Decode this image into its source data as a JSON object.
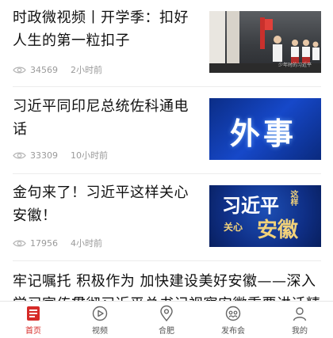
{
  "articles": [
    {
      "title": "时政微视频丨开学季：扣好人生的第一粒扣子",
      "views": "34569",
      "time": "2小时前",
      "thumb_caption": "少年时的习近平",
      "thumb_icon": "classroom-photo"
    },
    {
      "title": "习近平同印尼总统佐科通电话",
      "views": "33309",
      "time": "10小时前",
      "thumb_text": "外事",
      "thumb_icon": "waishi-banner"
    },
    {
      "title": "金句来了！习近平这样关心安徽！",
      "views": "17956",
      "time": "4小时前",
      "thumb_texts": [
        "习近平",
        "这样",
        "关心",
        "安徽"
      ],
      "thumb_icon": "anhui-banner"
    }
  ],
  "long_article": {
    "title": "牢记嘱托 积极作为 加快建设美好安徽——深入学习宣传贯彻习近平总书记视察安徽重要讲话精神"
  },
  "tabbar": {
    "items": [
      {
        "label": "首页",
        "icon": "home-icon",
        "active": true
      },
      {
        "label": "视频",
        "icon": "video-icon",
        "active": false
      },
      {
        "label": "合肥",
        "icon": "location-icon",
        "active": false
      },
      {
        "label": "发布会",
        "icon": "press-icon",
        "active": false
      },
      {
        "label": "我的",
        "icon": "user-icon",
        "active": false
      }
    ]
  },
  "colors": {
    "accent": "#d62a27",
    "meta_text": "#9a9a9a",
    "divider": "#ececec"
  }
}
